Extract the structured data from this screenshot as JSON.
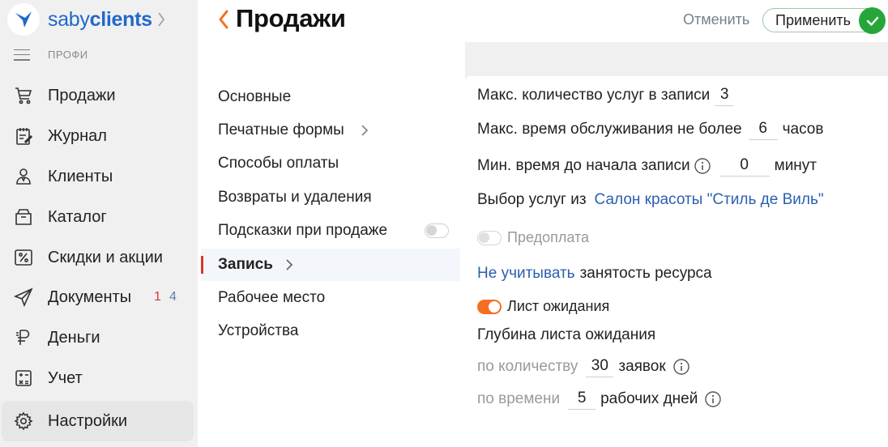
{
  "app": {
    "brand_prefix": "saby",
    "brand_bold": "clients",
    "plan": "ПРОФИ"
  },
  "colors": {
    "brand": "#2268c9",
    "accent_orange": "#f46f22",
    "apply_green": "#26a63a",
    "badge_red": "#d9373b",
    "link_blue": "#2a5fb0"
  },
  "sidebar": {
    "items": [
      {
        "label": "Продажи",
        "icon": "cart-icon"
      },
      {
        "label": "Журнал",
        "icon": "journal-icon"
      },
      {
        "label": "Клиенты",
        "icon": "clients-icon"
      },
      {
        "label": "Каталог",
        "icon": "catalog-icon"
      },
      {
        "label": "Скидки и акции",
        "icon": "discount-icon"
      },
      {
        "label": "Документы",
        "icon": "send-icon",
        "badge_red": "1",
        "badge_gray": "4"
      },
      {
        "label": "Деньги",
        "icon": "ruble-icon"
      },
      {
        "label": "Учет",
        "icon": "accounting-icon"
      },
      {
        "label": "Настройки",
        "icon": "gear-icon",
        "active": true
      }
    ]
  },
  "header": {
    "title": "Продажи",
    "cancel_label": "Отменить",
    "apply_label": "Применить"
  },
  "settings_menu": {
    "items": [
      {
        "label": "Основные"
      },
      {
        "label": "Печатные формы",
        "has_chevron": true
      },
      {
        "label": "Способы оплаты"
      },
      {
        "label": "Возвраты и удаления"
      },
      {
        "label": "Подсказки при продаже",
        "toggle": "off"
      },
      {
        "label": "Запись",
        "has_chevron": true,
        "active": true
      },
      {
        "label": "Рабочее место"
      },
      {
        "label": "Устройства"
      }
    ]
  },
  "content": {
    "max_services": {
      "label": "Макс. количество услуг в записи",
      "value": "3"
    },
    "max_service_time": {
      "label": "Макс. время обслуживания не более",
      "value": "6",
      "unit": "часов"
    },
    "min_time_before": {
      "label": "Мин. время до начала записи",
      "value": "0",
      "unit": "минут"
    },
    "services_from": {
      "label": "Выбор услуг из",
      "link": "Салон красоты \"Стиль де Виль\""
    },
    "prepayment": {
      "label": "Предоплата",
      "enabled": false
    },
    "resource": {
      "link": "Не учитывать",
      "label": "занятость ресурса"
    },
    "waitlist": {
      "label": "Лист ожидания",
      "enabled": true
    },
    "waitlist_depth": {
      "title": "Глубина листа ожидания",
      "by_count": {
        "label": "по количеству",
        "value": "30",
        "unit": "заявок"
      },
      "by_time": {
        "label": "по времени",
        "value": "5",
        "unit": "рабочих дней"
      }
    }
  }
}
